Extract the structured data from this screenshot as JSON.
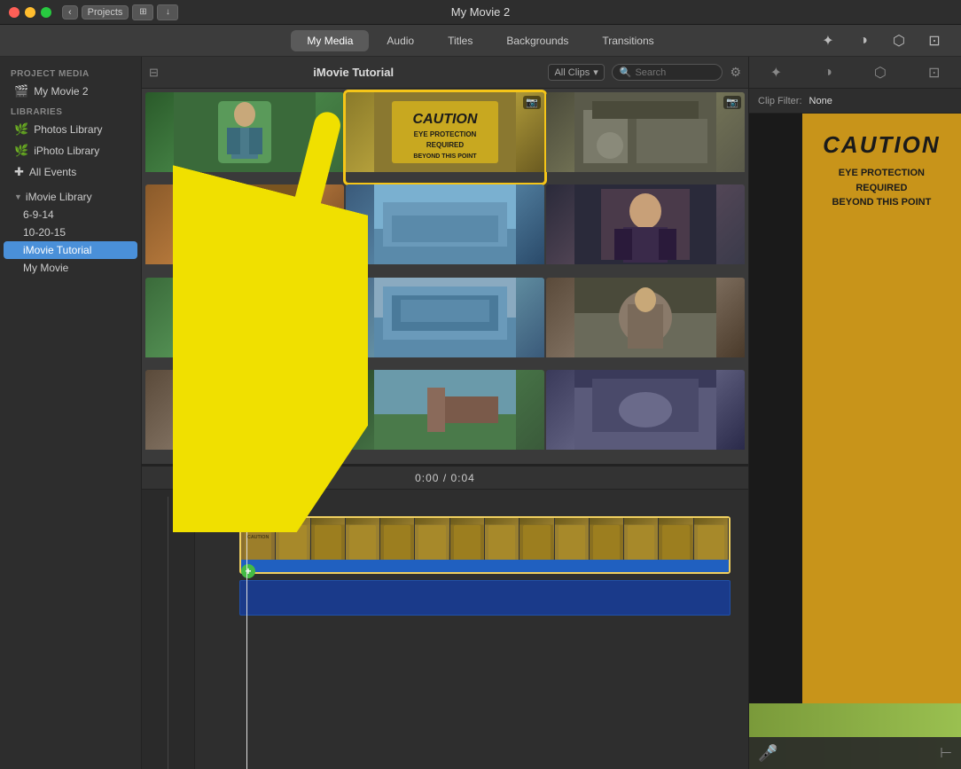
{
  "window": {
    "title": "My Movie 2",
    "buttons": {
      "close": "×",
      "minimize": "−",
      "maximize": "+"
    }
  },
  "titlebar": {
    "projects_label": "Projects",
    "back_icon": "‹",
    "down_icon": "↓"
  },
  "toolbar": {
    "tabs": [
      {
        "id": "my-media",
        "label": "My Media",
        "active": true
      },
      {
        "id": "audio",
        "label": "Audio",
        "active": false
      },
      {
        "id": "titles",
        "label": "Titles",
        "active": false
      },
      {
        "id": "backgrounds",
        "label": "Backgrounds",
        "active": false
      },
      {
        "id": "transitions",
        "label": "Transitions",
        "active": false
      }
    ]
  },
  "sidebar": {
    "project_media_header": "PROJECT MEDIA",
    "project_item": "My Movie 2",
    "libraries_header": "LIBRARIES",
    "library_items": [
      {
        "label": "Photos Library",
        "icon": "🌿"
      },
      {
        "label": "iPhoto Library",
        "icon": "🌿"
      },
      {
        "label": "All Events",
        "icon": "+"
      }
    ],
    "imovie_library": {
      "label": "iMovie Library",
      "children": [
        {
          "label": "6-9-14"
        },
        {
          "label": "10-20-15"
        },
        {
          "label": "iMovie Tutorial",
          "active": true
        },
        {
          "label": "My Movie"
        }
      ]
    }
  },
  "media_browser": {
    "title": "iMovie Tutorial",
    "filter_label": "All Clips",
    "search_placeholder": "Search",
    "thumbnails": [
      {
        "id": 1,
        "color_class": "tc-green",
        "has_camera": false
      },
      {
        "id": 2,
        "color_class": "tc-caution",
        "has_camera": true,
        "selected": true
      },
      {
        "id": 3,
        "color_class": "tc-industrial",
        "has_camera": true
      },
      {
        "id": 4,
        "color_class": "tc-dark",
        "has_camera": false
      },
      {
        "id": 5,
        "color_class": "tc-dark",
        "has_camera": false
      },
      {
        "id": 6,
        "color_class": "tc-dark",
        "has_camera": false
      },
      {
        "id": 7,
        "color_class": "tc-orange-brick",
        "has_camera": false
      },
      {
        "id": 8,
        "color_class": "tc-building",
        "has_camera": false
      },
      {
        "id": 9,
        "color_class": "tc-portrait",
        "has_camera": false
      },
      {
        "id": 10,
        "color_class": "tc-exterior",
        "has_camera": false
      },
      {
        "id": 11,
        "color_class": "tc-office",
        "has_camera": false
      },
      {
        "id": 12,
        "color_class": "tc-workshop",
        "has_camera": false
      },
      {
        "id": 13,
        "color_class": "tc-workshop",
        "has_camera": false
      },
      {
        "id": 14,
        "color_class": "tc-field",
        "has_camera": false
      },
      {
        "id": 15,
        "color_class": "tc-workshop2",
        "has_camera": false
      }
    ]
  },
  "right_panel": {
    "clip_filter_label": "Clip Filter:",
    "clip_filter_value": "None",
    "caution_title": "CAUTION",
    "caution_lines": [
      "EYE PROTECTION",
      "REQUIRED",
      "BEYOND THIS POINT"
    ]
  },
  "timeline": {
    "time_current": "0:00",
    "time_total": "0:04",
    "clip_duration": "4.0s",
    "add_label": "+"
  }
}
